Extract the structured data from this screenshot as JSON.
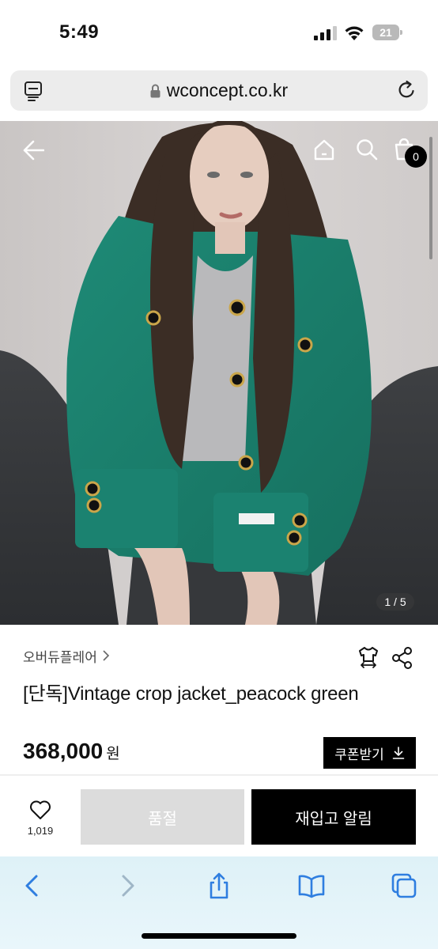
{
  "status_bar": {
    "time": "5:49",
    "battery": "21",
    "icons": [
      "signal-icon",
      "wifi-icon",
      "battery-icon"
    ]
  },
  "browser": {
    "url": "wconcept.co.kr",
    "icons": [
      "reader-icon",
      "lock-icon",
      "reload-icon"
    ]
  },
  "header": {
    "icons": [
      "back-arrow-icon",
      "home-icon",
      "search-icon",
      "cart-icon"
    ],
    "cart_count": "0"
  },
  "gallery": {
    "counter": "1 / 5"
  },
  "product": {
    "brand": "오버듀플레어",
    "title": "[단독]Vintage crop jacket_peacock green",
    "price": "368,000",
    "price_unit": "원",
    "coupon_label": "쿠폰받기",
    "icons": [
      "size-guide-tshirt-icon",
      "share-icon",
      "download-icon"
    ]
  },
  "actions": {
    "like_count": "1,019",
    "soldout_label": "품절",
    "restock_label": "재입고 알림",
    "icons": [
      "heart-icon"
    ]
  },
  "toolbar": {
    "icons": [
      "back-icon",
      "forward-icon",
      "share-icon",
      "bookmarks-icon",
      "tabs-icon"
    ]
  },
  "colors": {
    "accent_black": "#000000",
    "soldout_gray": "#dcdcdc",
    "toolbar_tint": "#def1f7",
    "jacket_green": "#1f8c78",
    "ios_blue": "#2f7ee0"
  }
}
